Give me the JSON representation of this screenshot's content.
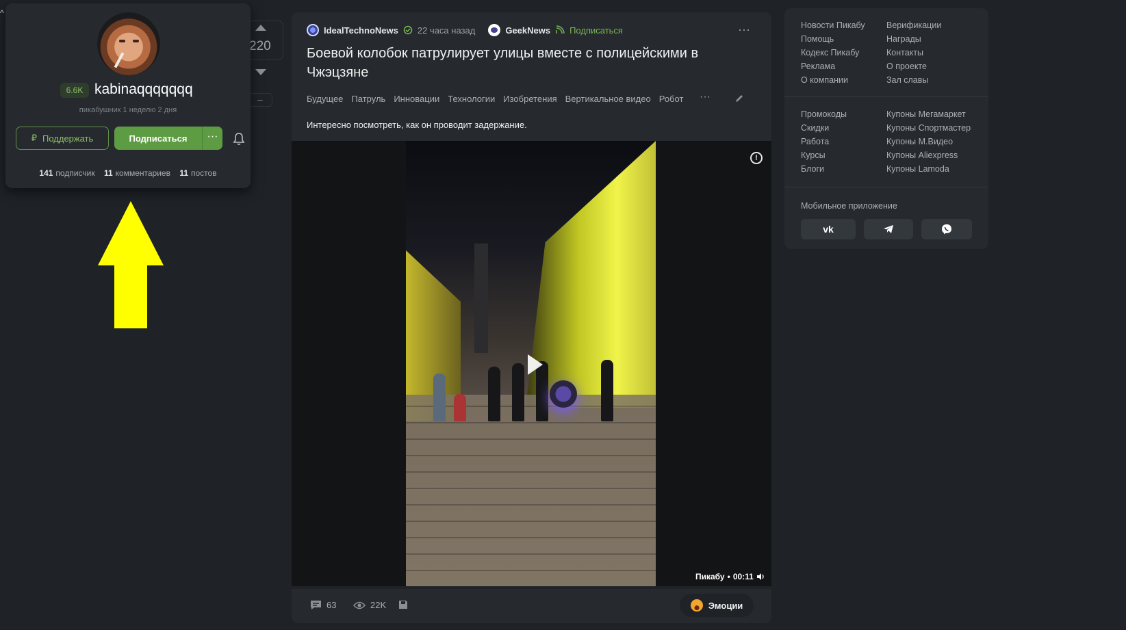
{
  "vote": {
    "count": "220",
    "minus": "–"
  },
  "profile": {
    "rating": "6.6K",
    "username": "kabinaqqqqqqq",
    "tenure": "пикабушник 1 неделю 2 дня",
    "support_label": "Поддержать",
    "support_icon": "₽",
    "subscribe_label": "Подписаться",
    "more_label": "···",
    "stats": {
      "subscribers_count": "141",
      "subscribers_label": "подписчик",
      "comments_count": "11",
      "comments_label": "комментариев",
      "posts_count": "11",
      "posts_label": "постов"
    }
  },
  "post": {
    "author": "IdealTechnoNews",
    "time_ago": "22 часа назад",
    "community": "GeekNews",
    "community_subscribe": "Подписаться",
    "menu": "···",
    "title": "Боевой колобок патрулирует улицы вместе с полицейскими в Чжэцзяне",
    "tags": [
      "Будущее",
      "Патруль",
      "Инновации",
      "Технологии",
      "Изобретения",
      "Вертикальное видео",
      "Робот"
    ],
    "tags_more": "···",
    "text": "Интересно посмотреть, как он проводит задержание.",
    "video": {
      "source": "Пикабу",
      "separator": "•",
      "duration": "00:11",
      "warning": "!"
    },
    "footer": {
      "comments": "63",
      "views": "22K",
      "emotions_label": "Эмоции"
    }
  },
  "sidebar": {
    "links_left_1": [
      "Новости Пикабу",
      "Помощь",
      "Кодекс Пикабу",
      "Реклама",
      "О компании"
    ],
    "links_right_1": [
      "Верификации",
      "Награды",
      "Контакты",
      "О проекте",
      "Зал славы"
    ],
    "links_left_2": [
      "Промокоды",
      "Скидки",
      "Работа",
      "Курсы",
      "Блоги"
    ],
    "links_right_2": [
      "Купоны Мегамаркет",
      "Купоны Спортмастер",
      "Купоны М.Видео",
      "Купоны Aliexpress",
      "Купоны Lamoda"
    ],
    "mobile_title": "Мобильное приложение",
    "apps": {
      "vk": "vk"
    }
  },
  "colors": {
    "accent_green": "#5e9c44",
    "background": "#1f2327",
    "card": "#262a2f",
    "arrow": "#ffff00"
  }
}
